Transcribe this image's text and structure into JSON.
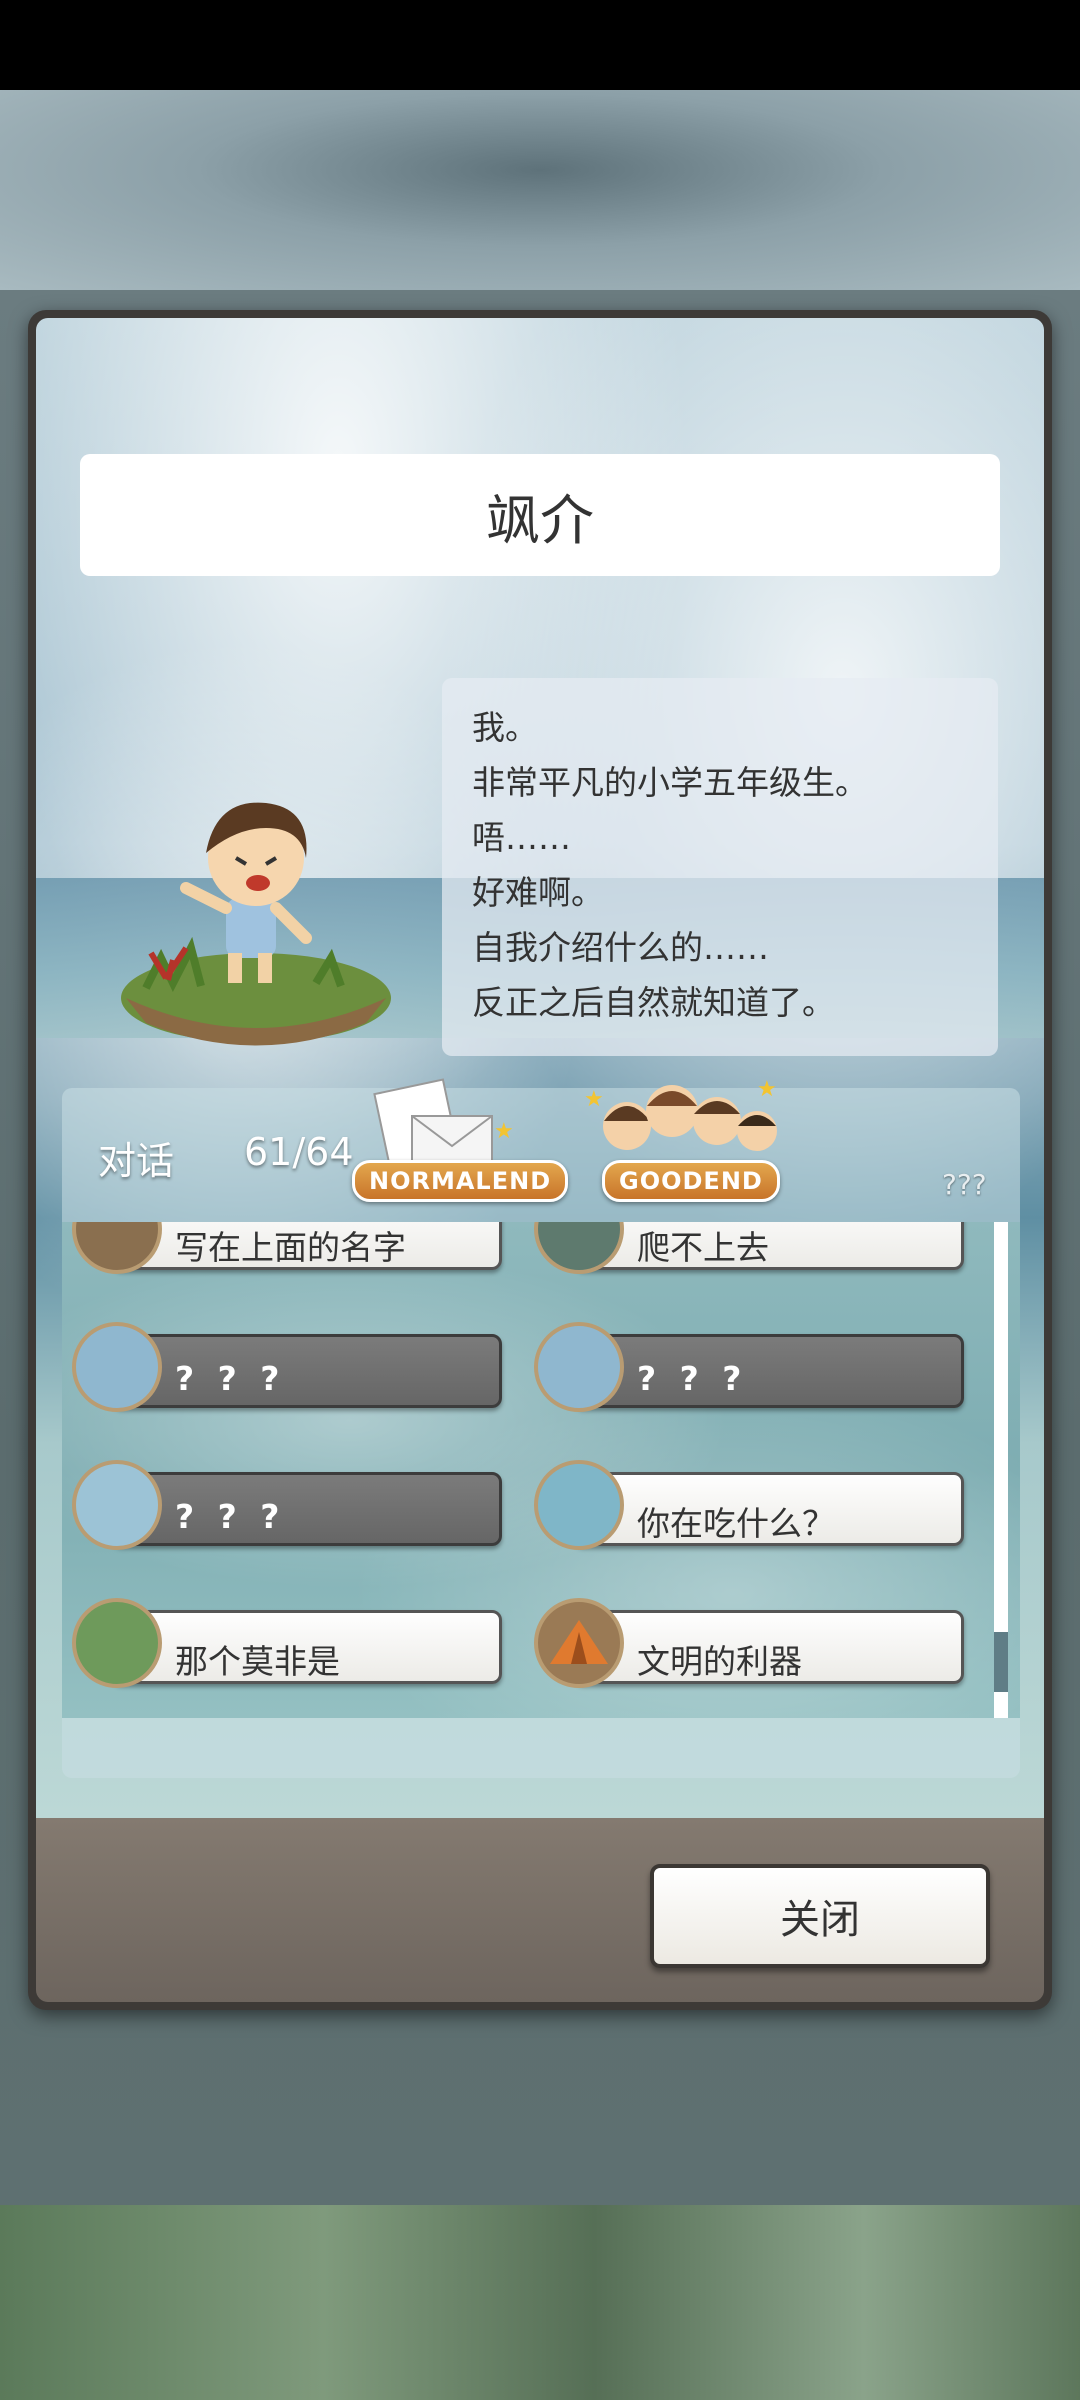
{
  "profile": {
    "name": "飒介",
    "bio": [
      "我。",
      "非常平凡的小学五年级生。",
      "唔……",
      "好难啊。",
      "自我介绍什么的……",
      "反正之后自然就知道了。"
    ]
  },
  "dialog_list": {
    "label": "对话",
    "count": "61/64",
    "badges": {
      "normal_end": "NORMALEND",
      "good_end": "GOODEND",
      "unknown": "???"
    },
    "items": [
      {
        "label": "写在上面的名字",
        "unlocked": true,
        "icon": "lighthouse-icon"
      },
      {
        "label": "爬不上去",
        "unlocked": true,
        "icon": "gate-icon"
      },
      {
        "label": "? ? ?",
        "unlocked": false,
        "icon": "house-icon"
      },
      {
        "label": "? ? ?",
        "unlocked": false,
        "icon": "house-icon"
      },
      {
        "label": "? ? ?",
        "unlocked": false,
        "icon": "lighthouse-icon"
      },
      {
        "label": "你在吃什么？",
        "unlocked": true,
        "icon": "beach-icon"
      },
      {
        "label": "那个莫非是",
        "unlocked": true,
        "icon": "cabin-icon"
      },
      {
        "label": "文明的利器",
        "unlocked": true,
        "icon": "tent-icon"
      }
    ]
  },
  "footer": {
    "close_label": "关闭"
  }
}
